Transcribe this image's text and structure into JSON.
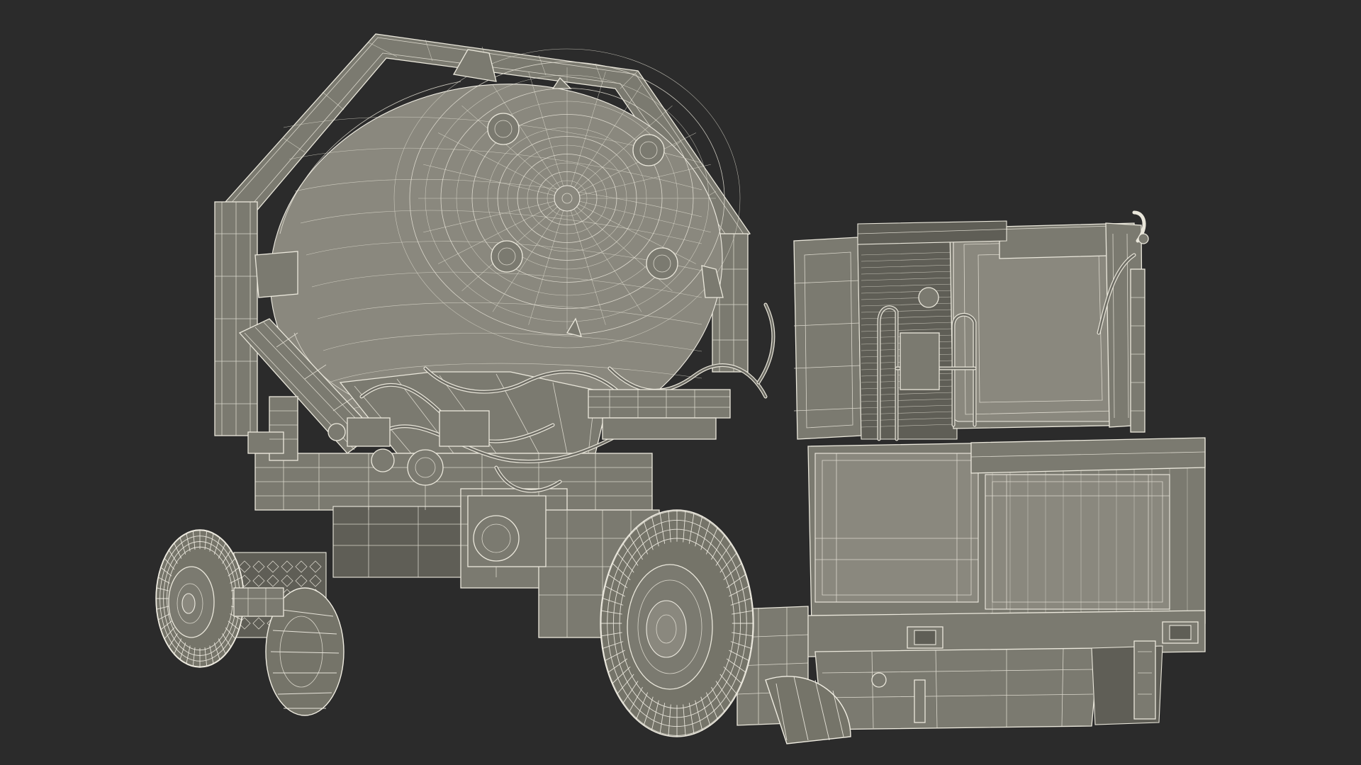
{
  "scene": {
    "background": "#2b2b2b",
    "mesh_fill": "#7b7a70",
    "wire_color": "#ebe8dc",
    "subject": "mining-concrete-mixer-truck-wireframe"
  }
}
